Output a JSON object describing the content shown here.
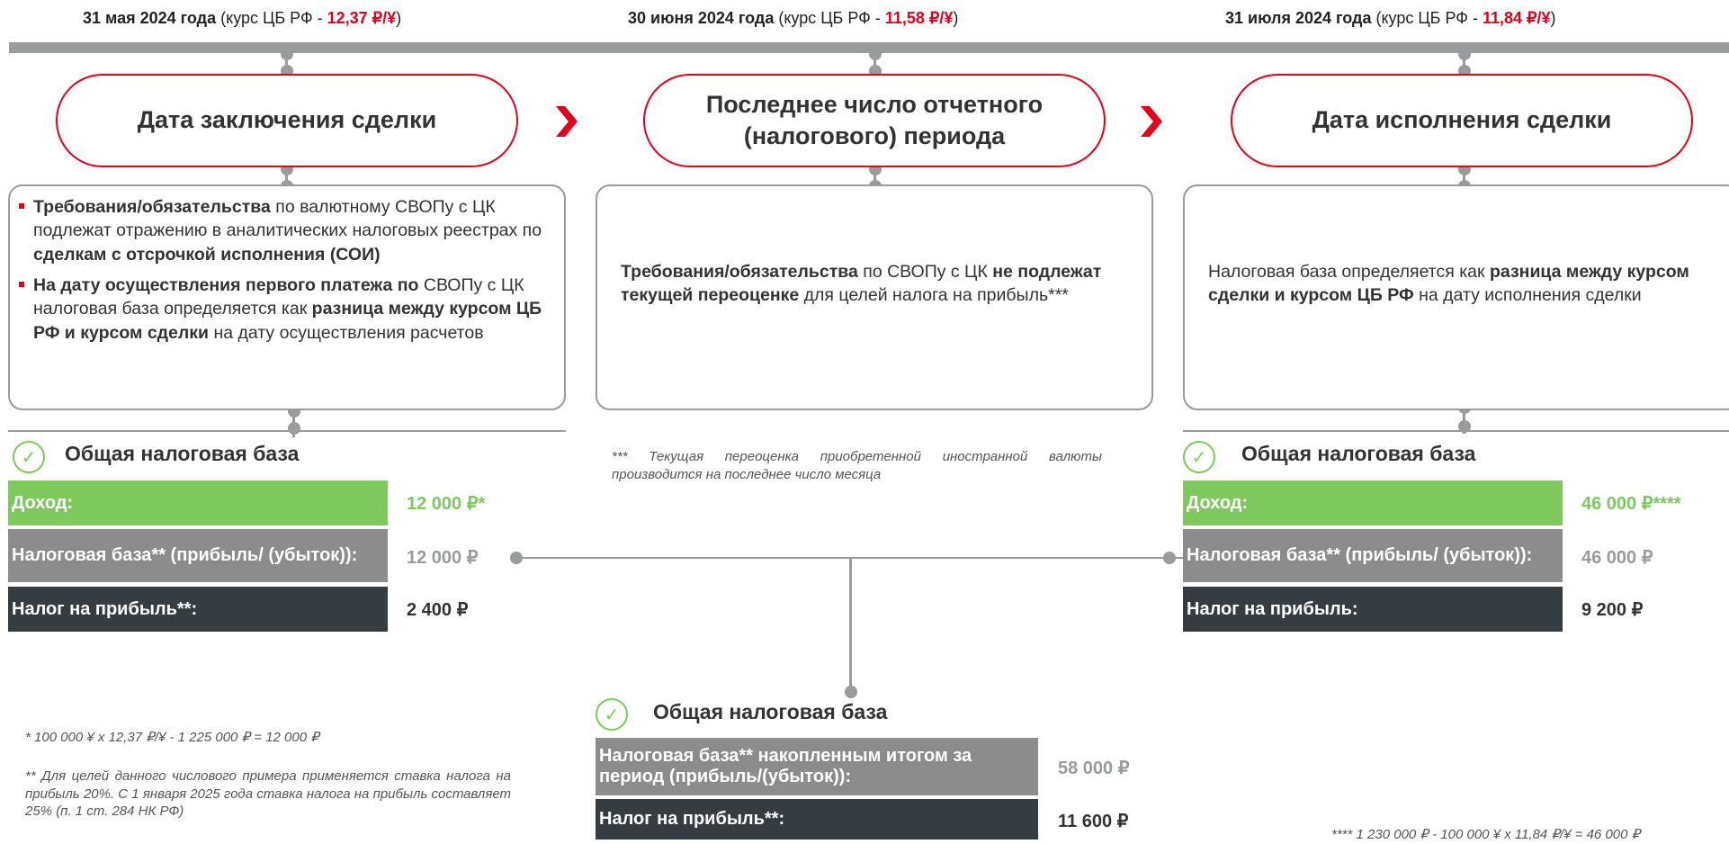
{
  "header": {
    "d1": {
      "date": "31 мая 2024 года",
      "pre": " (курс ЦБ РФ - ",
      "rate": "12,37 ₽/¥",
      "post": ")"
    },
    "d2": {
      "date": "30 июня 2024 года",
      "pre": " (курс ЦБ РФ - ",
      "rate": "11,58 ₽/¥",
      "post": ")"
    },
    "d3": {
      "date": "31 июля 2024 года",
      "pre": " (курс ЦБ РФ - ",
      "rate": "11,84 ₽/¥",
      "post": ")"
    }
  },
  "stages": {
    "s1": "Дата заключения сделки",
    "s2_line1": "Последнее число отчетного",
    "s2_line2": "(налогового) периода",
    "s3": "Дата исполнения сделки"
  },
  "box1": {
    "b1_bold1": "Требования/обязательства",
    "b1_t1": " по валютному СВОПу с ЦК подлежат отражению в аналитических налоговых реестрах по ",
    "b1_bold2": "сделкам с отсрочкой исполнения (СОИ)",
    "b2_bold1": "На дату осуществления первого платежа по",
    "b2_t1": " СВОПу с ЦК налоговая база определяется как ",
    "b2_bold2": "разница между курсом ЦБ РФ и курсом сделки",
    "b2_t2": " на дату осуществления расчетов"
  },
  "box2": {
    "bold1": "Требования/обязательства",
    "t1": " по СВОПу с ЦК ",
    "bold2": "не подлежат текущей переоценке",
    "t2": " для целей налога на прибыль***"
  },
  "box3": {
    "t1": "Налоговая база определяется как ",
    "bold1": "разница между курсом сделки и курсом ЦБ РФ",
    "t2": " на дату исполнения сделки"
  },
  "left_table": {
    "title": "Общая налоговая база",
    "r1_label": "Доход:",
    "r1_value": "12 000 ₽*",
    "r2_label": "Налоговая база** (прибыль/ (убыток)):",
    "r2_value": "12 000 ₽",
    "r3_label": "Налог на прибыль**:",
    "r3_value": "2 400 ₽"
  },
  "right_table": {
    "title": "Общая налоговая база",
    "r1_label": "Доход:",
    "r1_value": "46 000 ₽****",
    "r2_label": "Налоговая база** (прибыль/ (убыток)):",
    "r2_value": "46 000 ₽",
    "r3_label": "Налог на прибыль:",
    "r3_value": "9 200 ₽"
  },
  "center_table": {
    "title": "Общая налоговая база",
    "r1_label": "Налоговая база** накопленным итогом за период (прибыль/(убыток)):",
    "r1_value": "58 000 ₽",
    "r2_label": "Налог на прибыль**:",
    "r2_value": "11 600 ₽"
  },
  "notes": {
    "triple": "*** Текущая переоценка приобретенной иностранной валюты производится на последнее число месяца",
    "single": "* 100 000 ¥ x 12,37 ₽/¥ - 1 225 000 ₽ = 12 000 ₽",
    "double": "** Для целей данного числового примера применяется ставка налога на прибыль 20%. С 1 января 2025 года ставка налога на прибыль составляет 25% (п. 1 ст. 284 НК РФ)",
    "quad": "**** 1 230 000 ₽ - 100 000 ¥ x 11,84 ₽/¥ = 46 000 ₽"
  },
  "colors": {
    "accent_red": "#e3001b",
    "green": "#7dc95e",
    "gray": "#8c8c8c",
    "dark": "#363d42",
    "line": "#9a9b9d"
  },
  "icons": {
    "check": "check-circle-icon",
    "arrow": "chevron-right-icon"
  }
}
